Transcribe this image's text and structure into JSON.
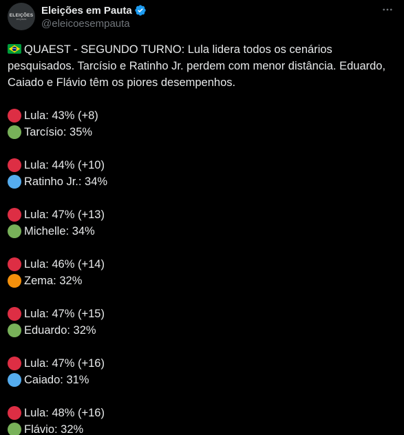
{
  "account": {
    "display_name": "Eleições em Pauta",
    "handle": "@eleicoesempauta",
    "avatar_text": "ELEIÇÕES",
    "avatar_subtext": "em pauta",
    "verified": true
  },
  "post": {
    "intro_text": "QUAEST - SEGUNDO TURNO: Lula lidera todos os cenários pesquisados. Tarcísio e Ratinho Jr. perdem com menor distância. Eduardo, Caiado e Flávio têm os piores desempenhos.",
    "flag_icon": "brazil-flag-icon",
    "scenarios": [
      {
        "lines": [
          {
            "text": "Lula: 43% (+8)",
            "color": "#dd2e44"
          },
          {
            "text": "Tarcísio: 35%",
            "color": "#78b159"
          }
        ]
      },
      {
        "lines": [
          {
            "text": "Lula: 44% (+10)",
            "color": "#dd2e44"
          },
          {
            "text": "Ratinho Jr.: 34%",
            "color": "#55acee"
          }
        ]
      },
      {
        "lines": [
          {
            "text": "Lula: 47% (+13)",
            "color": "#dd2e44"
          },
          {
            "text": "Michelle: 34%",
            "color": "#78b159"
          }
        ]
      },
      {
        "lines": [
          {
            "text": "Lula: 46% (+14)",
            "color": "#dd2e44"
          },
          {
            "text": "Zema: 32%",
            "color": "#f4900c"
          }
        ]
      },
      {
        "lines": [
          {
            "text": "Lula: 47% (+15)",
            "color": "#dd2e44"
          },
          {
            "text": "Eduardo: 32%",
            "color": "#78b159"
          }
        ]
      },
      {
        "lines": [
          {
            "text": "Lula: 47% (+16)",
            "color": "#dd2e44"
          },
          {
            "text": "Caiado: 31%",
            "color": "#55acee"
          }
        ]
      },
      {
        "lines": [
          {
            "text": "Lula: 48% (+16)",
            "color": "#dd2e44"
          },
          {
            "text": "Flávio: 32%",
            "color": "#78b159"
          }
        ]
      }
    ]
  },
  "colors": {
    "background": "#000000",
    "text": "#e7e9ea",
    "muted": "#71767b",
    "verified": "#1d9bf0"
  },
  "icons": {
    "more": "more-options-icon",
    "verified": "verified-badge-icon"
  }
}
